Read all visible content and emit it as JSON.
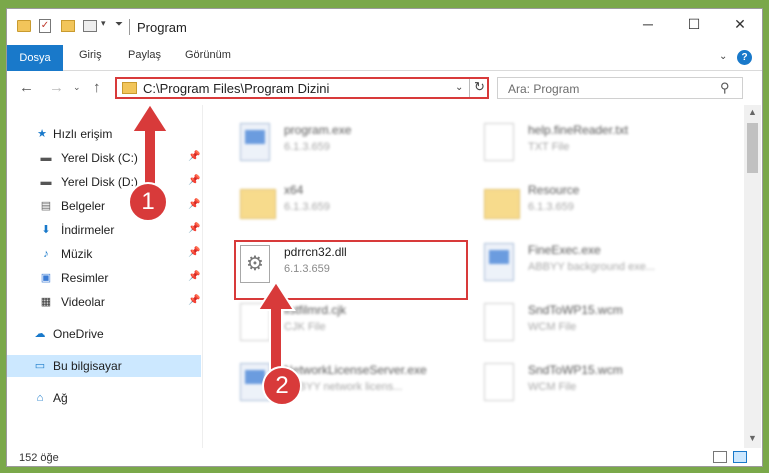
{
  "window": {
    "title": "Program",
    "minimize": "─",
    "maximize": "☐",
    "close": "✕"
  },
  "ribbon": {
    "tabs": [
      "Dosya",
      "Giriş",
      "Paylaş",
      "Görünüm"
    ],
    "help": "?",
    "accent": "#1979ca"
  },
  "nav": {
    "address": "C:\\Program Files\\Program Dizini",
    "search_placeholder": "Ara: Program"
  },
  "sidebar": {
    "items": [
      {
        "label": "Hızlı erişim",
        "icon": "star-icon"
      },
      {
        "label": "Yerel Disk (C:)",
        "icon": "drive-icon"
      },
      {
        "label": "Yerel Disk (D:)",
        "icon": "drive-icon"
      },
      {
        "label": "Belgeler",
        "icon": "documents-icon"
      },
      {
        "label": "İndirmeler",
        "icon": "download-icon"
      },
      {
        "label": "Müzik",
        "icon": "music-icon"
      },
      {
        "label": "Resimler",
        "icon": "pictures-icon"
      },
      {
        "label": "Videolar",
        "icon": "video-icon"
      },
      {
        "label": "OneDrive",
        "icon": "cloud-icon"
      },
      {
        "label": "Bu bilgisayar",
        "icon": "computer-icon"
      },
      {
        "label": "Ağ",
        "icon": "network-icon"
      }
    ]
  },
  "files": [
    {
      "name": "program.exe",
      "sub": "6.1.3.659",
      "type": "exe"
    },
    {
      "name": "help.fineReader.txt",
      "sub": "TXT File",
      "type": "doc"
    },
    {
      "name": "x64",
      "sub": "6.1.3.659",
      "type": "folder"
    },
    {
      "name": "Resource",
      "sub": "6.1.3.659",
      "type": "folder"
    },
    {
      "name": "pdrrcn32.dll",
      "sub": "6.1.3.659",
      "type": "dll"
    },
    {
      "name": "FineExec.exe",
      "sub": "ABBYY background exe...",
      "type": "exe"
    },
    {
      "name": "listfilmrd.cjk",
      "sub": "CJK File",
      "type": "doc"
    },
    {
      "name": "SndToWP15.wcm",
      "sub": "WCM File",
      "type": "doc"
    },
    {
      "name": "NetworkLicenseServer.exe",
      "sub": "ABBYY network licens...",
      "type": "exe"
    },
    {
      "name": "SndToWP15.wcm",
      "sub": "WCM File",
      "type": "doc"
    }
  ],
  "status": {
    "count": "152 öğe"
  },
  "annotations": {
    "step1": "1",
    "step2": "2",
    "color": "#d83a3a"
  }
}
